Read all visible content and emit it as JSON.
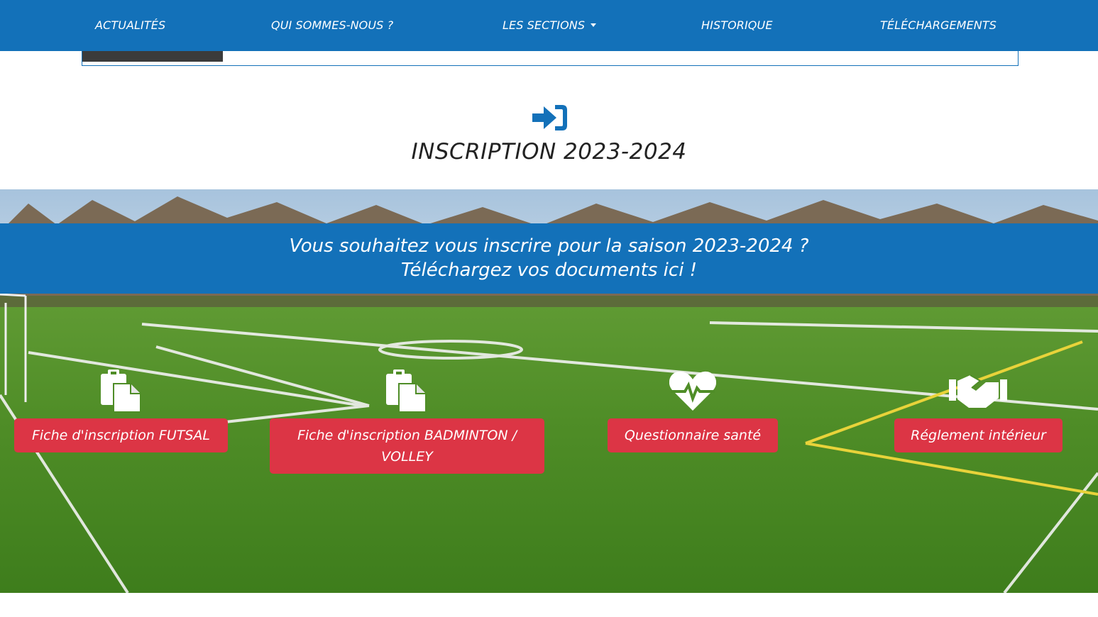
{
  "nav": {
    "items": [
      {
        "label": "ACTUALITÉS"
      },
      {
        "label": "QUI SOMMES-NOUS ?"
      },
      {
        "label": "LES SECTIONS"
      },
      {
        "label": "HISTORIQUE"
      },
      {
        "label": "TÉLÉCHARGEMENTS"
      }
    ]
  },
  "page": {
    "icon": "sign-in-icon",
    "title": "INSCRIPTION 2023-2024"
  },
  "hero": {
    "line1": "Vous souhaitez vous inscrire pour la saison 2023-2024 ?",
    "line2": "Téléchargez vos documents ici !"
  },
  "documents": [
    {
      "icon": "clipboard-copy-icon",
      "label": "Fiche d'inscription FUTSAL"
    },
    {
      "icon": "clipboard-copy-icon",
      "label": "Fiche d'inscription BADMINTON / VOLLEY"
    },
    {
      "icon": "heartbeat-icon",
      "label": "Questionnaire santé"
    },
    {
      "icon": "handshake-icon",
      "label": "Réglement intérieur"
    }
  ],
  "colors": {
    "primary": "#1371b9",
    "button": "#dc3545",
    "text": "#222222"
  }
}
